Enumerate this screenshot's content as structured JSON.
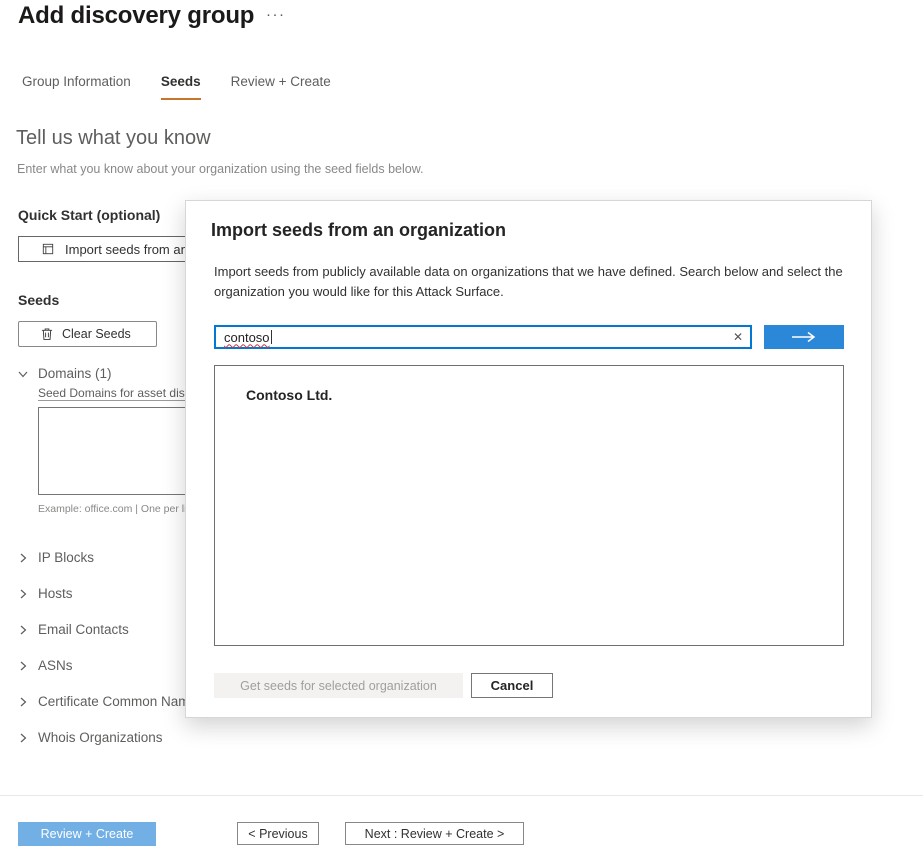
{
  "page": {
    "title": "Add discovery group",
    "more_icon": "···"
  },
  "tabs": [
    {
      "label": "Group Information",
      "active": false
    },
    {
      "label": "Seeds",
      "active": true
    },
    {
      "label": "Review + Create",
      "active": false
    }
  ],
  "intro": {
    "heading": "Tell us what you know",
    "description": "Enter what you know about your organization using the seed fields below."
  },
  "quick_start": {
    "label": "Quick Start (optional)",
    "import_button_label": "Import seeds from an organization"
  },
  "seeds": {
    "section_label": "Seeds",
    "clear_button_label": "Clear Seeds",
    "domains": {
      "label": "Domains (1)",
      "field_label": "Seed Domains for asset discovery",
      "textarea_value": "",
      "example": "Example: office.com | One per line"
    },
    "collapsed_sections": [
      {
        "label": "IP Blocks"
      },
      {
        "label": "Hosts"
      },
      {
        "label": "Email Contacts"
      },
      {
        "label": "ASNs"
      },
      {
        "label": "Certificate Common Names"
      },
      {
        "label": "Whois Organizations"
      }
    ]
  },
  "modal": {
    "title": "Import seeds from an organization",
    "description": "Import seeds from publicly available data on organizations that we have defined. Search below and select the organization you would like for this Attack Surface.",
    "search": {
      "value": "contoso",
      "clear_icon": "✕"
    },
    "results": [
      {
        "name": "Contoso Ltd."
      }
    ],
    "get_seeds_button_label": "Get seeds for selected organization",
    "cancel_button_label": "Cancel"
  },
  "footer": {
    "review_create_label": "Review + Create",
    "previous_label": "< Previous",
    "next_label": "Next : Review + Create >"
  },
  "colors": {
    "accent": "#0078D4",
    "tabUnderline": "#C8742B",
    "arrowButton": "#2B88D8",
    "primaryLight": "#71AFE5",
    "spellcheckRed": "#D13438",
    "textDark": "#242424",
    "textBody": "#605E5C",
    "textMuted": "#8A8886",
    "border": "#8A8886",
    "divider": "#E8E8E8",
    "disabledBg": "#F3F2F1",
    "disabledText": "#A19F9D"
  }
}
